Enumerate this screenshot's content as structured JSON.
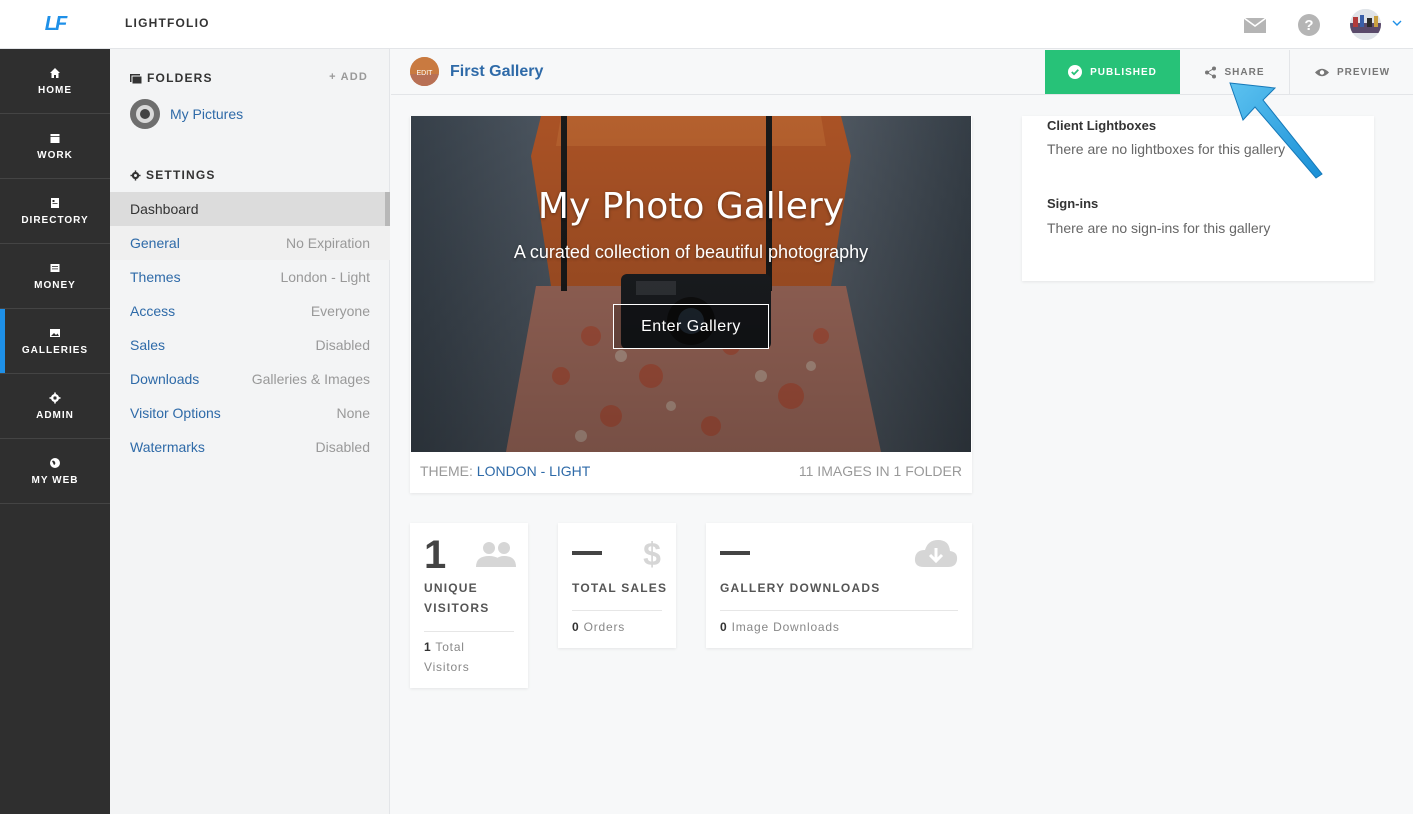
{
  "app": {
    "logo": "LF",
    "brand": "LIGHTFOLIO"
  },
  "nav": {
    "items": [
      {
        "label": "HOME",
        "icon": "home-icon"
      },
      {
        "label": "WORK",
        "icon": "calendar-icon"
      },
      {
        "label": "DIRECTORY",
        "icon": "address-book-icon"
      },
      {
        "label": "MONEY",
        "icon": "ledger-icon"
      },
      {
        "label": "GALLERIES",
        "icon": "image-icon",
        "active": true
      },
      {
        "label": "ADMIN",
        "icon": "gear-icon"
      },
      {
        "label": "MY WEB",
        "icon": "globe-icon"
      }
    ]
  },
  "folders": {
    "heading": "FOLDERS",
    "add_label": "+ ADD",
    "items": [
      {
        "name": "My Pictures"
      }
    ]
  },
  "settings": {
    "heading": "SETTINGS",
    "rows": [
      {
        "name": "Dashboard",
        "value": ""
      },
      {
        "name": "General",
        "value": "No Expiration"
      },
      {
        "name": "Themes",
        "value": "London - Light"
      },
      {
        "name": "Access",
        "value": "Everyone"
      },
      {
        "name": "Sales",
        "value": "Disabled"
      },
      {
        "name": "Downloads",
        "value": "Galleries & Images"
      },
      {
        "name": "Visitor Options",
        "value": "None"
      },
      {
        "name": "Watermarks",
        "value": "Disabled"
      }
    ]
  },
  "gallery": {
    "title": "First Gallery",
    "thumb_label": "EDIT",
    "published_label": "PUBLISHED",
    "share_label": "SHARE",
    "preview_label": "PREVIEW"
  },
  "hero": {
    "title": "My Photo Gallery",
    "subtitle": "A curated collection of beautiful photography",
    "button": "Enter Gallery",
    "theme_prefix": "THEME:",
    "theme_name": "LONDON - LIGHT",
    "image_count": "11 IMAGES IN 1 FOLDER"
  },
  "stats": {
    "visitors": {
      "value": "1",
      "label_1": "UNIQUE",
      "label_2": "VISITORS",
      "foot_num": "1",
      "foot_1": "Total",
      "foot_2": "Visitors"
    },
    "sales": {
      "label": "TOTAL SALES",
      "foot_num": "0",
      "foot_text": "Orders"
    },
    "downloads": {
      "label": "GALLERY DOWNLOADS",
      "foot_num": "0",
      "foot_text": "Image Downloads"
    }
  },
  "info": {
    "lightboxes_heading": "Client Lightboxes",
    "lightboxes_text": "There are no lightboxes for this gallery",
    "signins_heading": "Sign-ins",
    "signins_text": "There are no sign-ins for this gallery"
  },
  "colors": {
    "accent": "#1e90e8",
    "published": "#27c278",
    "link": "#2e6aa8",
    "nav_bg": "#2f2f2f"
  }
}
